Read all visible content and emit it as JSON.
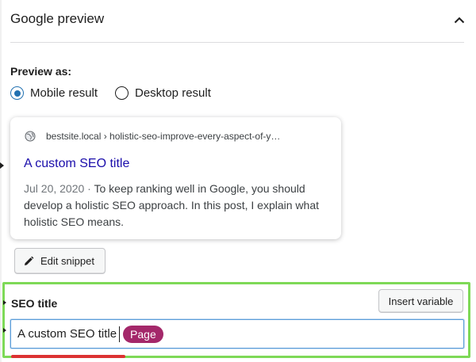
{
  "panel": {
    "title": "Google preview",
    "collapse_icon": "chevron-up-icon"
  },
  "preview": {
    "label": "Preview as:",
    "options": [
      {
        "label": "Mobile result",
        "checked": true
      },
      {
        "label": "Desktop result",
        "checked": false
      }
    ]
  },
  "snippet": {
    "url": "bestsite.local › holistic-seo-improve-every-aspect-of-y…",
    "title": "A custom SEO title",
    "date": "Jul 20, 2020",
    "separator": " · ",
    "description": "To keep ranking well in Google, you should develop a holistic SEO approach. In this post, I explain what holistic SEO means.",
    "favicon_icon": "globe-icon"
  },
  "edit_snippet": {
    "label": "Edit snippet",
    "icon": "pencil-icon"
  },
  "seo_title": {
    "label": "SEO title",
    "insert_variable_label": "Insert variable",
    "value_text": "A custom SEO title",
    "variable_pill": "Page",
    "progress_color": "#dc3232"
  },
  "colors": {
    "accent": "#2271b1",
    "link": "#1a0dab",
    "pill": "#a4286a",
    "highlight": "#7ed957"
  }
}
